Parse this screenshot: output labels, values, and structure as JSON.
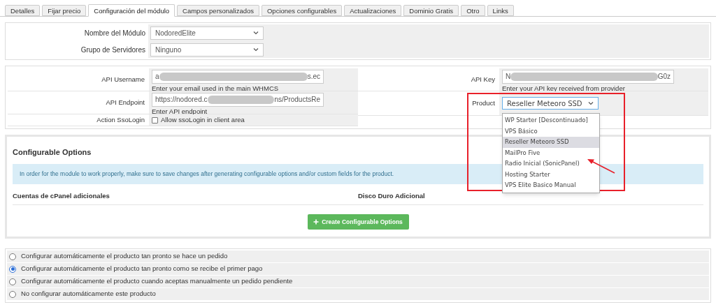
{
  "tabs": [
    {
      "label": "Detalles",
      "selected": false
    },
    {
      "label": "Fijar precio",
      "selected": false
    },
    {
      "label": "Configuración del módulo",
      "selected": true
    },
    {
      "label": "Campos personalizados",
      "selected": false
    },
    {
      "label": "Opciones configurables",
      "selected": false
    },
    {
      "label": "Actualizaciones",
      "selected": false
    },
    {
      "label": "Dominio Gratis",
      "selected": false
    },
    {
      "label": "Otro",
      "selected": false
    },
    {
      "label": "Links",
      "selected": false
    }
  ],
  "module": [
    {
      "label": "Nombre del Módulo",
      "value": "NodoredElite"
    },
    {
      "label": "Grupo de Servidores",
      "value": "Ninguno"
    }
  ],
  "api": {
    "left": [
      {
        "kind": "text",
        "label": "API Username",
        "value_start": "a",
        "value_end": "s.ec",
        "hint": "Enter your email used in the main WHMCS"
      },
      {
        "kind": "text",
        "label": "API Endpoint",
        "value_start": "https://nodored.c",
        "value_end": "ns/ProductsRe",
        "hint": "Enter API endpoint"
      },
      {
        "kind": "checkbox",
        "label": "Action SsoLogin",
        "option": "Allow ssoLogin in client area",
        "checked": false
      }
    ],
    "right": [
      {
        "kind": "text",
        "label": "API Key",
        "value_start": "N",
        "value_end": "G0z",
        "hint": "Enter your API key received from provider"
      },
      {
        "kind": "select",
        "label": "Product",
        "value": "Reseller Meteoro SSD",
        "expanded": true,
        "options": [
          {
            "label": "WP Starter [Descontinuado]",
            "selected": false
          },
          {
            "label": "VPS Básico",
            "selected": false
          },
          {
            "label": "Reseller Meteoro SSD",
            "selected": true
          },
          {
            "label": "MailPro Five",
            "selected": false
          },
          {
            "label": "Radio Inicial (SonicPanel)",
            "selected": false
          },
          {
            "label": "Hosting Starter",
            "selected": false
          },
          {
            "label": "VPS Elite Basico Manual",
            "selected": false
          }
        ]
      }
    ]
  },
  "configurable_options": {
    "title": "Configurable Options",
    "notice": "In order for the module to work properly, make sure to save changes after generating configurable options and/or custom fields for the product.",
    "columns": [
      "Cuentas de cPanel adicionales",
      "Disco Duro Adicional"
    ],
    "button": "Create Configurable Options"
  },
  "provisioning": [
    {
      "label": "Configurar automáticamente el producto tan pronto se hace un pedido",
      "selected": false
    },
    {
      "label": "Configurar automáticamente el producto tan pronto como se recibe el primer pago",
      "selected": true
    },
    {
      "label": "Configurar automáticamente el producto cuando aceptas manualmente un pedido pendiente",
      "selected": false
    },
    {
      "label": "No configurar automáticamente este producto",
      "selected": false
    }
  ]
}
